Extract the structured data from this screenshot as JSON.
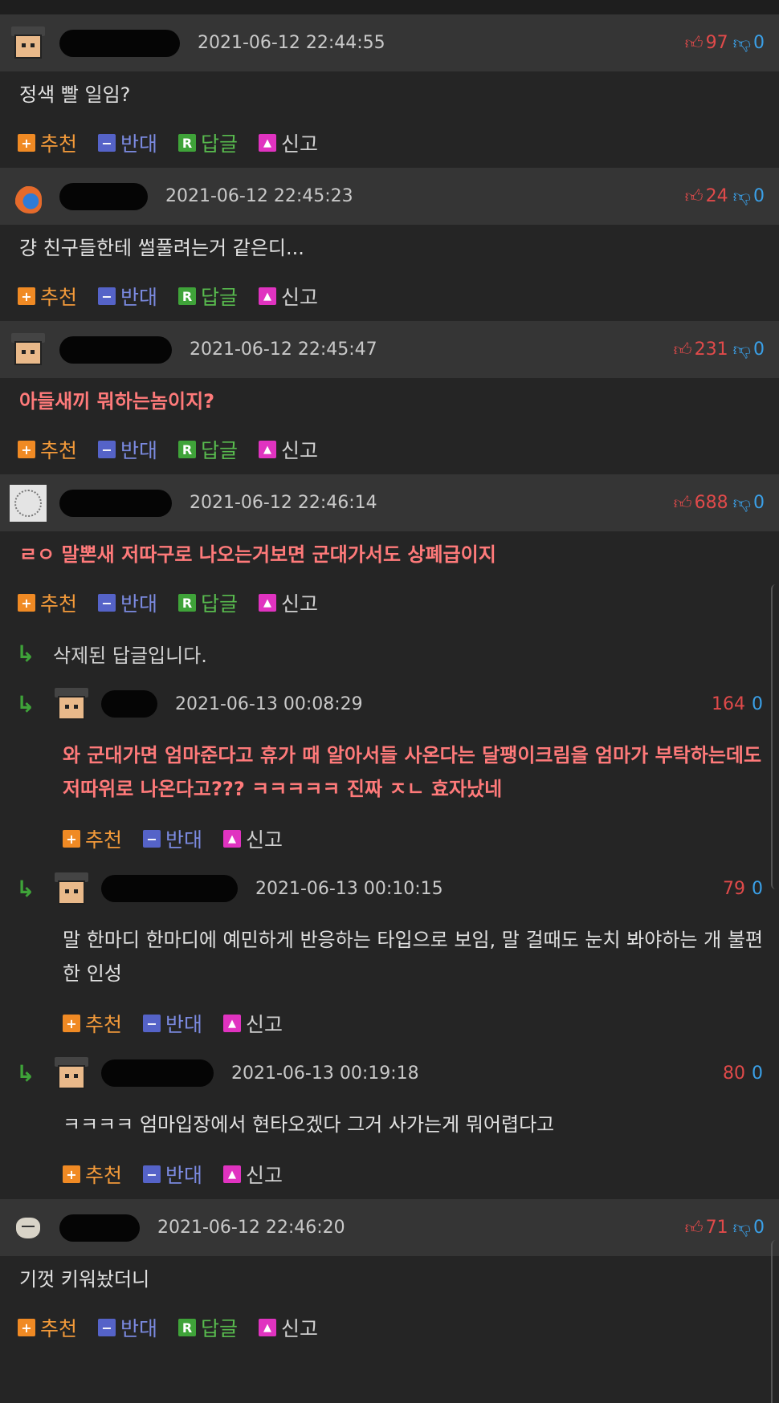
{
  "actions": {
    "recommend": "추천",
    "oppose": "반대",
    "reply": "답글",
    "report": "신고"
  },
  "comments": [
    {
      "date": "2021-06-12 22:44:55",
      "up": "97",
      "down": "0",
      "text": "정색 빨 일임?",
      "style": "plain",
      "avatar": "face-icon"
    },
    {
      "date": "2021-06-12 22:45:23",
      "up": "24",
      "down": "0",
      "text": "걍 친구들한테 썰풀려는거 같은디...",
      "style": "plain",
      "avatar": "fire-icon"
    },
    {
      "date": "2021-06-12 22:45:47",
      "up": "231",
      "down": "0",
      "text": "아들새끼 뭐하는놈이지?",
      "style": "hot",
      "avatar": "face-icon"
    },
    {
      "date": "2021-06-12 22:46:14",
      "up": "688",
      "down": "0",
      "text": "ㄹㅇ 말뽄새 저따구로 나오는거보면 군대가서도 상폐급이지",
      "style": "hot",
      "avatar": "doodle-icon"
    },
    {
      "date": "2021-06-12 22:46:20",
      "up": "71",
      "down": "0",
      "text": "기껏 키워놨더니",
      "style": "plain",
      "avatar": "cat-icon"
    }
  ],
  "deleted_reply": "삭제된 답글입니다.",
  "replies": [
    {
      "date": "2021-06-13 00:08:29",
      "up": "164",
      "down": "0",
      "text": "와 군대가면 엄마준다고 휴가 때 알아서들 사온다는 달팽이크림을 엄마가 부탁하는데도 저따위로 나온다고??? ㅋㅋㅋㅋㅋ 진짜 ㅈㄴ 효자났네",
      "style": "hot"
    },
    {
      "date": "2021-06-13 00:10:15",
      "up": "79",
      "down": "0",
      "text": "말 한마디 한마디에 예민하게 반응하는 타입으로 보임, 말 걸때도 눈치 봐야하는 개 불편한 인성",
      "style": "plain"
    },
    {
      "date": "2021-06-13 00:19:18",
      "up": "80",
      "down": "0",
      "text": "ㅋㅋㅋㅋ 엄마입장에서 현타오겠다 그거 사가는게 뭐어렵다고",
      "style": "plain"
    }
  ]
}
